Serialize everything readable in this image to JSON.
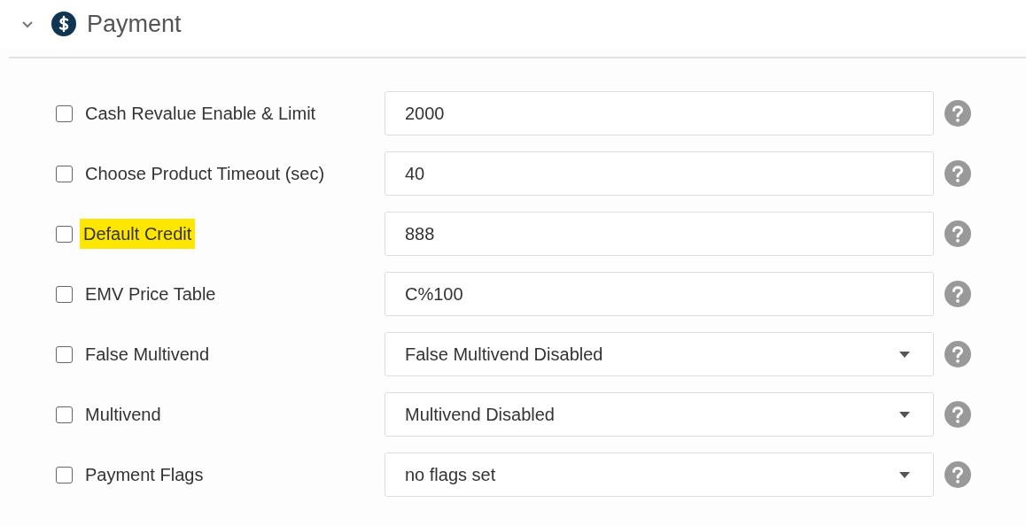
{
  "section": {
    "title": "Payment",
    "expanded": true
  },
  "settings": [
    {
      "label": "Cash Revalue Enable & Limit",
      "checked": false,
      "highlighted": false,
      "kind": "input",
      "value": "2000"
    },
    {
      "label": "Choose Product Timeout (sec)",
      "checked": false,
      "highlighted": false,
      "kind": "input",
      "value": "40"
    },
    {
      "label": "Default Credit",
      "checked": false,
      "highlighted": true,
      "kind": "input",
      "value": "888"
    },
    {
      "label": "EMV Price Table",
      "checked": false,
      "highlighted": false,
      "kind": "input",
      "value": "C%100"
    },
    {
      "label": "False Multivend",
      "checked": false,
      "highlighted": false,
      "kind": "select",
      "value": "False Multivend Disabled"
    },
    {
      "label": "Multivend",
      "checked": false,
      "highlighted": false,
      "kind": "select",
      "value": "Multivend Disabled"
    },
    {
      "label": "Payment Flags",
      "checked": false,
      "highlighted": false,
      "kind": "select",
      "value": "no flags set"
    }
  ]
}
